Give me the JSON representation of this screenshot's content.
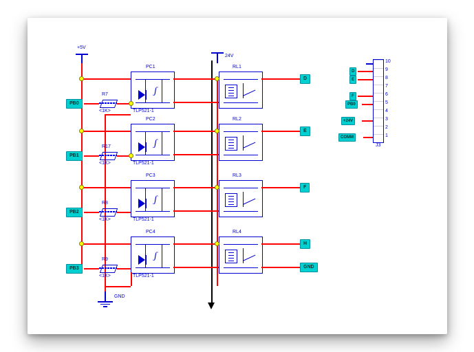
{
  "power": {
    "rail_left": "+5V",
    "rail_mid": "24V",
    "gnd": "GND"
  },
  "rows": [
    {
      "port": "PB0",
      "res_ref": "R7",
      "res_val": "<1K>",
      "ic_ref": "PC1",
      "ic_part": "TLP521-1",
      "rly_ref": "RL1",
      "out": "D"
    },
    {
      "port": "PB1",
      "res_ref": "R17",
      "res_val": "<1K>",
      "ic_ref": "PC2",
      "ic_part": "TLP521-1",
      "rly_ref": "RL2",
      "out": "E"
    },
    {
      "port": "PB2",
      "res_ref": "R8",
      "res_val": "<1K>",
      "ic_ref": "PC3",
      "ic_part": "TLP521-1",
      "rly_ref": "RL3",
      "out": "F"
    },
    {
      "port": "PB3",
      "res_ref": "R9",
      "res_val": "<1K>",
      "ic_ref": "PC4",
      "ic_part": "TLP521-1",
      "rly_ref": "RL4",
      "out": "H",
      "out2": "GND"
    }
  ],
  "connector": {
    "ref": "J3",
    "pins": [
      {
        "n": "10",
        "lab": ""
      },
      {
        "n": "9",
        "lab": "D"
      },
      {
        "n": "8",
        "lab": "E"
      },
      {
        "n": "7",
        "lab": ""
      },
      {
        "n": "6",
        "lab": "F"
      },
      {
        "n": "5",
        "lab": "PB0"
      },
      {
        "n": "4",
        "lab": ""
      },
      {
        "n": "3",
        "lab": "+24V"
      },
      {
        "n": "2",
        "lab": ""
      },
      {
        "n": "1",
        "lab": "COMM"
      }
    ]
  }
}
